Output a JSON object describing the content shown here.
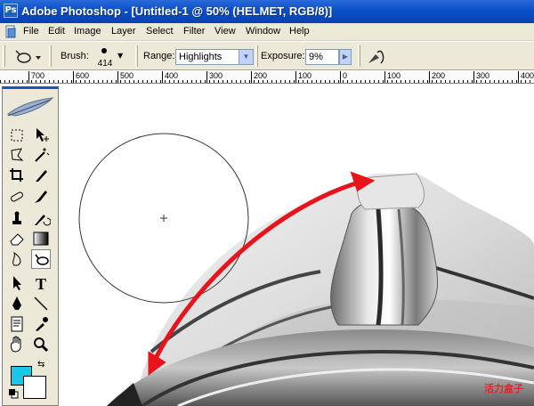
{
  "window": {
    "title": "Adobe Photoshop - [Untitled-1 @ 50% (HELMET, RGB/8)]"
  },
  "menu": {
    "items": [
      "File",
      "Edit",
      "Image",
      "Layer",
      "Select",
      "Filter",
      "View",
      "Window",
      "Help"
    ]
  },
  "options": {
    "tool_icon": "dodge-tool-icon",
    "brush_label": "Brush:",
    "brush_size": "414",
    "range_label": "Range:",
    "range_value": "Highlights",
    "exposure_label": "Exposure:",
    "exposure_value": "9%",
    "airbrush_icon": "airbrush-icon"
  },
  "ruler": {
    "ticks": [
      "700",
      "600",
      "500",
      "400",
      "300",
      "200",
      "100",
      "0",
      "100",
      "200",
      "300",
      "400"
    ]
  },
  "toolbox": {
    "tools": [
      "marquee-tool-icon",
      "move-tool-icon",
      "lasso-tool-icon",
      "magic-wand-tool-icon",
      "crop-tool-icon",
      "slice-tool-icon",
      "healing-brush-tool-icon",
      "brush-tool-icon",
      "clone-stamp-tool-icon",
      "history-brush-tool-icon",
      "eraser-tool-icon",
      "gradient-tool-icon",
      "blur-tool-icon",
      "dodge-tool-icon",
      "path-selection-tool-icon",
      "type-tool-icon",
      "pen-tool-icon",
      "line-tool-icon",
      "notes-tool-icon",
      "eyedropper-tool-icon",
      "hand-tool-icon",
      "zoom-tool-icon"
    ],
    "selected_tool": "dodge-tool-icon",
    "foreground_color": "#1bc6e6",
    "background_color": "#ffffff"
  },
  "watermark": "活力盒子",
  "colors": {
    "title_bar": "#0a4fc8",
    "arrow": "#e8131b",
    "chrome": "#ece9d8"
  }
}
